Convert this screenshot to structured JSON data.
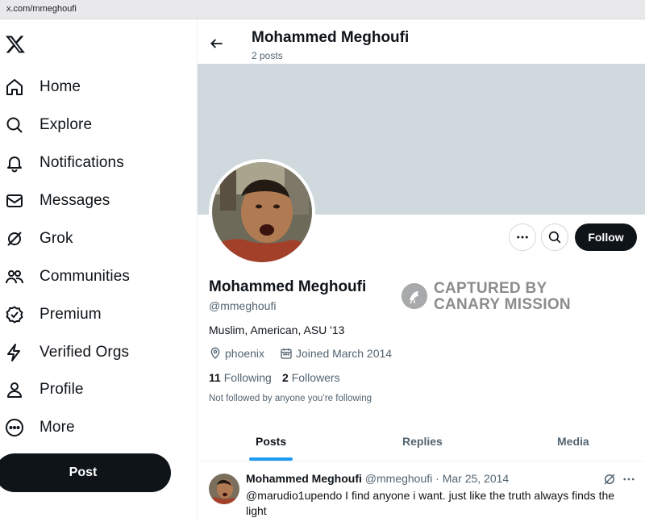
{
  "browser": {
    "url": "x.com/mmeghoufi"
  },
  "sidebar": {
    "items": [
      {
        "label": "Home",
        "icon": "home-icon"
      },
      {
        "label": "Explore",
        "icon": "search-icon"
      },
      {
        "label": "Notifications",
        "icon": "bell-icon"
      },
      {
        "label": "Messages",
        "icon": "envelope-icon"
      },
      {
        "label": "Grok",
        "icon": "grok-icon"
      },
      {
        "label": "Communities",
        "icon": "people-icon"
      },
      {
        "label": "Premium",
        "icon": "verified-badge-icon"
      },
      {
        "label": "Verified Orgs",
        "icon": "lightning-icon"
      },
      {
        "label": "Profile",
        "icon": "person-icon"
      },
      {
        "label": "More",
        "icon": "more-circle-icon"
      }
    ],
    "post_label": "Post"
  },
  "header": {
    "name": "Mohammed Meghoufi",
    "post_count": "2 posts"
  },
  "profile": {
    "name": "Mohammed Meghoufi",
    "handle": "@mmeghoufi",
    "bio": "Muslim, American, ASU '13",
    "location": "phoenix",
    "joined": "Joined March 2014",
    "following_count": "11",
    "following_label": "Following",
    "followers_count": "2",
    "followers_label": "Followers",
    "not_followed": "Not followed by anyone you’re following",
    "follow_label": "Follow"
  },
  "watermark": {
    "line1": "CAPTURED BY",
    "line2": "CANARY MISSION"
  },
  "tabs": [
    {
      "label": "Posts"
    },
    {
      "label": "Replies"
    },
    {
      "label": "Media"
    }
  ],
  "tweet": {
    "name": "Mohammed Meghoufi",
    "handle": "@mmeghoufi",
    "sep": "·",
    "date": "Mar 25, 2014",
    "text": "@marudio1upendo I find anyone i want. just like the truth always finds the light"
  }
}
